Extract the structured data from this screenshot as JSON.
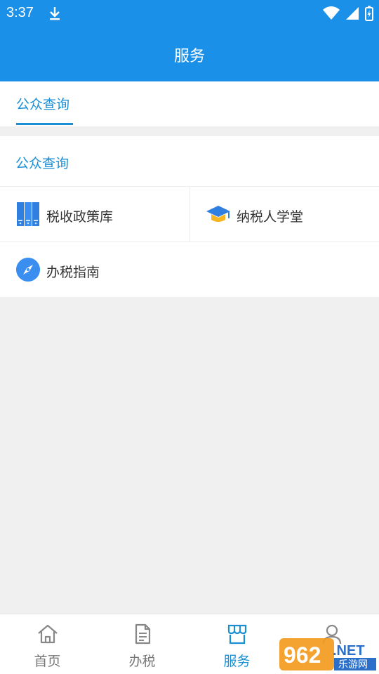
{
  "status": {
    "time": "3:37"
  },
  "header": {
    "title": "服务"
  },
  "tabs": [
    {
      "label": "公众查询",
      "active": true
    }
  ],
  "section": {
    "title": "公众查询",
    "items": [
      {
        "label": "税收政策库",
        "icon": "books-icon"
      },
      {
        "label": "纳税人学堂",
        "icon": "graduation-cap-icon"
      },
      {
        "label": "办税指南",
        "icon": "compass-icon"
      }
    ]
  },
  "bottom_nav": [
    {
      "label": "首页",
      "icon": "home-icon",
      "active": false
    },
    {
      "label": "办税",
      "icon": "document-icon",
      "active": false
    },
    {
      "label": "服务",
      "icon": "store-icon",
      "active": true
    },
    {
      "label": "",
      "icon": "user-icon",
      "active": false
    }
  ],
  "watermark": {
    "text_main": "962.NET",
    "text_sub": "乐游网"
  },
  "colors": {
    "primary": "#1a90e8",
    "accent_text": "#1a8fd4",
    "background": "#f0f0f0"
  }
}
